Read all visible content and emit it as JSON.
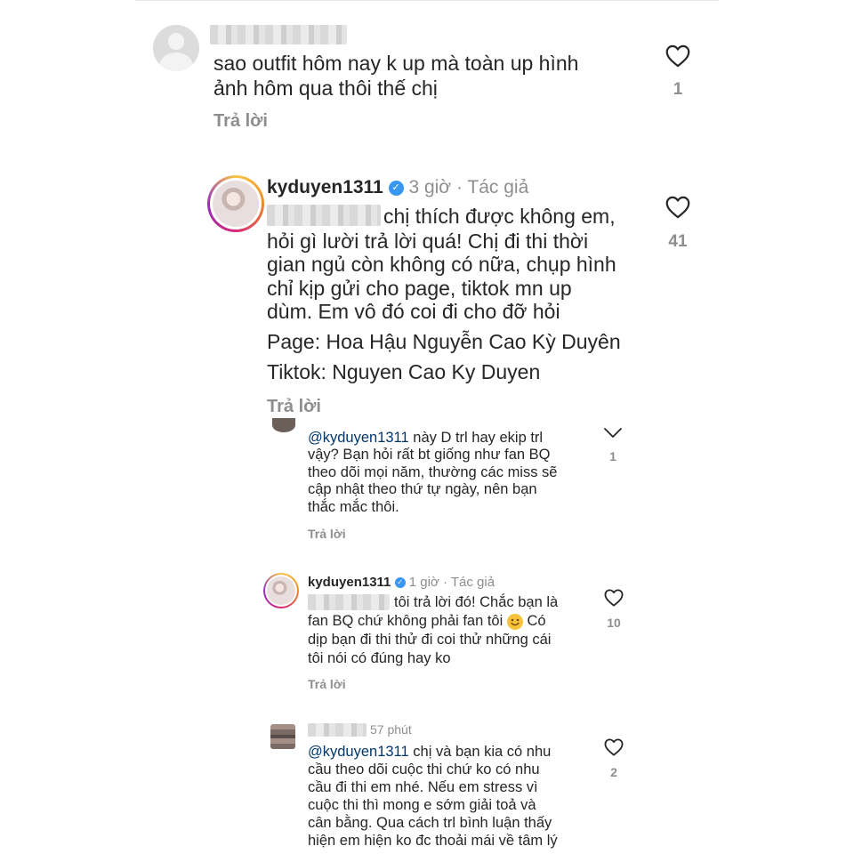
{
  "comments": [
    {
      "lines": [
        "sao outfit hôm nay k up mà toàn up hình",
        "ảnh hôm qua thôi thế chị"
      ],
      "reply_label": "Trả lời",
      "likes": "1",
      "icon": "heart-icon"
    },
    {
      "username": "kyduyen1311",
      "time": "3 giờ",
      "separator": "·",
      "author_tag": "Tác giả",
      "lines": [
        "chị thích được không em,",
        "hỏi gì lười trả lời quá! Chị đi thi thời",
        "gian ngủ còn không có nữa, chụp hình",
        "chỉ kịp gửi cho page, tiktok mn up",
        "dùm. Em vô đó coi đi cho đỡ hỏi",
        "Page: Hoa Hậu Nguyễn Cao Kỳ Duyên",
        "Tiktok: Nguyen Cao Ky Duyen"
      ],
      "reply_label": "Trả lời",
      "likes": "41"
    },
    {
      "mention": "@kyduyen1311",
      "lines": [
        "này D trl hay ekip trl",
        "vậy? Bạn hỏi rất bt giống như fan BQ",
        "theo dõi mọi năm, thường các miss sẽ",
        "cập nhật theo thứ tự ngày, nên bạn",
        "thắc mắc thôi."
      ],
      "reply_label": "Trả lời",
      "likes": "1"
    },
    {
      "username": "kyduyen1311",
      "time": "1 giờ",
      "separator": "·",
      "author_tag": "Tác giả",
      "lines": [
        "tôi trả lời đó! Chắc bạn là",
        "fan BQ chứ không phải fan tôi",
        "Có",
        "dịp bạn đi thi thử đi coi thử những cái",
        "tôi nói có đúng hay ko"
      ],
      "reply_label": "Trả lời",
      "likes": "10"
    },
    {
      "time": "57 phút",
      "mention": "@kyduyen1311",
      "lines": [
        "chị và bạn kia có nhu",
        "cầu theo dõi cuộc thi chứ ko có nhu",
        "cầu đi thi em nhé. Nếu em stress vì",
        "cuộc thi thì mong e sớm giải toả và",
        "cân bằng. Qua cách trl bình luận thấy",
        "hiện em hiện ko đc thoải mái về tâm lý"
      ],
      "likes": "2"
    }
  ],
  "colors": {
    "text": "#262626",
    "meta": "#8e8e8e",
    "mention": "#00376b",
    "verified": "#3897f0"
  }
}
